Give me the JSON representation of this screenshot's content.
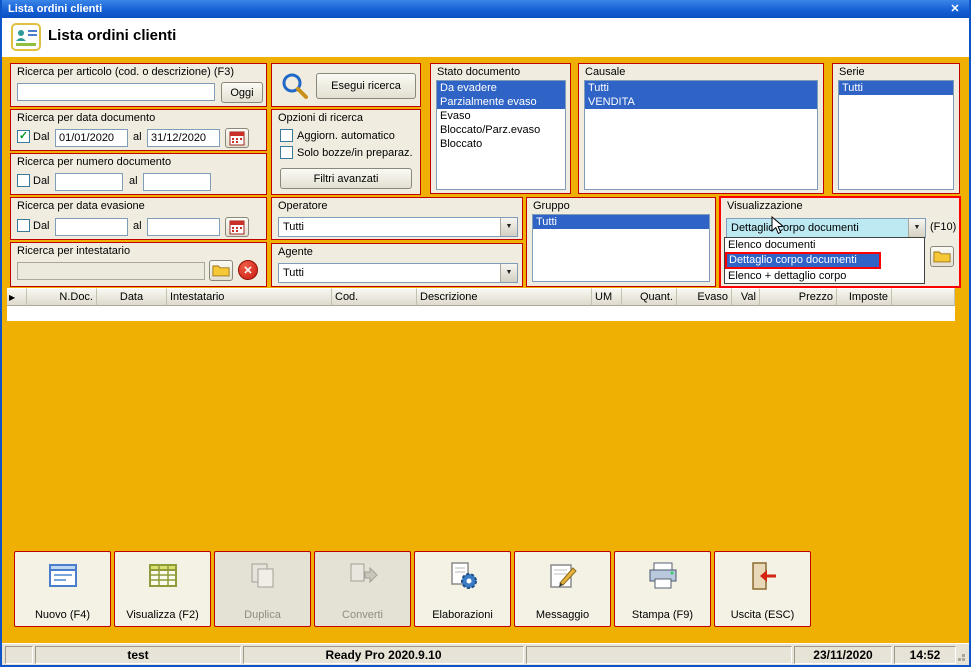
{
  "window": {
    "title": "Lista ordini clienti"
  },
  "icons": {
    "close": "✕",
    "row_indicator": "▶"
  },
  "header": {
    "title": "Lista ordini clienti"
  },
  "panels": {
    "articolo": {
      "label": "Ricerca per articolo (cod. o descrizione) (F3)",
      "value": "",
      "oggi_button": "Oggi"
    },
    "data_documento": {
      "label": "Ricerca per data documento",
      "dal": "Dal",
      "al": "al",
      "from": "01/01/2020",
      "to": "31/12/2020"
    },
    "numero_documento": {
      "label": "Ricerca per numero documento",
      "dal": "Dal",
      "al": "al",
      "from": "",
      "to": ""
    },
    "data_evasione": {
      "label": "Ricerca per data evasione",
      "dal": "Dal",
      "al": "al",
      "from": "",
      "to": ""
    },
    "intestatario": {
      "label": "Ricerca per intestatario",
      "value": ""
    },
    "ricerca": {
      "esegui_button": "Esegui ricerca"
    },
    "opzioni": {
      "label": "Opzioni di ricerca",
      "aggiorn_label": "Aggiorn. automatico",
      "bozze_label": "Solo bozze/in preparaz.",
      "filtri_button": "Filtri avanzati"
    },
    "operatore": {
      "label": "Operatore",
      "value": "Tutti"
    },
    "agente": {
      "label": "Agente",
      "value": "Tutti"
    },
    "stato_documento": {
      "label": "Stato documento",
      "items": [
        {
          "label": "Da evadere",
          "selected": true
        },
        {
          "label": "Parzialmente evaso",
          "selected": true
        },
        {
          "label": "Evaso",
          "selected": false
        },
        {
          "label": "Bloccato/Parz.evaso",
          "selected": false
        },
        {
          "label": "Bloccato",
          "selected": false
        }
      ]
    },
    "causale": {
      "label": "Causale",
      "items": [
        {
          "label": "Tutti",
          "selected": true
        },
        {
          "label": "VENDITA",
          "selected": true
        }
      ]
    },
    "serie": {
      "label": "Serie",
      "items": [
        {
          "label": "Tutti",
          "selected": true
        }
      ]
    },
    "gruppo": {
      "label": "Gruppo",
      "items": [
        {
          "label": "Tutti",
          "selected": true
        }
      ]
    },
    "visualizzazione": {
      "label": "Visualizzazione",
      "value": "Dettaglio corpo documenti",
      "f10_label": "(F10)",
      "options": [
        "Elenco documenti",
        "Dettaglio corpo documenti",
        "Elenco + dettaglio corpo"
      ],
      "selected_option": "Dettaglio corpo documenti"
    }
  },
  "table": {
    "columns": [
      "N.Doc.",
      "Data",
      "Intestatario",
      "Cod.",
      "Descrizione",
      "UM",
      "Quant.",
      "Evaso",
      "Val",
      "Prezzo",
      "Imposte"
    ]
  },
  "toolbar": {
    "buttons": [
      {
        "label": "Nuovo (F4)",
        "enabled": true
      },
      {
        "label": "Visualizza (F2)",
        "enabled": true
      },
      {
        "label": "Duplica",
        "enabled": false
      },
      {
        "label": "Converti",
        "enabled": false
      },
      {
        "label": "Elaborazioni",
        "enabled": true
      },
      {
        "label": "Messaggio",
        "enabled": true
      },
      {
        "label": "Stampa (F9)",
        "enabled": true
      },
      {
        "label": "Uscita (ESC)",
        "enabled": true
      }
    ]
  },
  "statusbar": {
    "user": "test",
    "version": "Ready Pro 2020.9.10",
    "date": "23/11/2020",
    "time": "14:52"
  },
  "colors": {
    "background": "#EFB003",
    "panel_border": "#C00000",
    "selection": "#2F63C6",
    "annotation": "#FF0000",
    "combo_highlight": "#BCE9F2",
    "titlebar": "#0D55C6"
  }
}
